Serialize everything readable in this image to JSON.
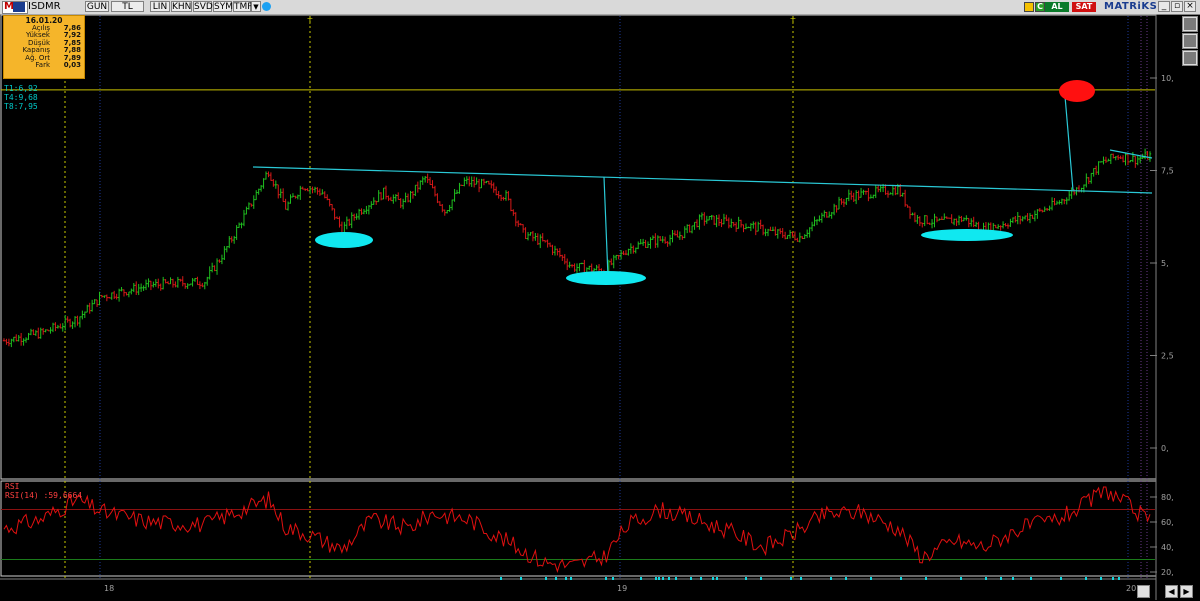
{
  "toolbar": {
    "symbol": "ISDMR",
    "buttons": [
      "GUN",
      "TL",
      "LIN",
      "KHN",
      "SVD",
      "SYM",
      "TMP"
    ],
    "al_label": "AL",
    "sat_label": "SAT",
    "brand": "MATRiKS"
  },
  "infobox": {
    "date": "16.01.20",
    "rows": [
      {
        "label": "Açılış",
        "value": "7,86"
      },
      {
        "label": "Yüksek",
        "value": "7,92"
      },
      {
        "label": "Düşük",
        "value": "7,85"
      },
      {
        "label": "Kapanış",
        "value": "7,88"
      },
      {
        "label": "Ağ. Ort",
        "value": "7,89"
      },
      {
        "label": "Fark",
        "value": "0,03"
      }
    ]
  },
  "trend_labels": [
    "T1:6,92",
    "T4:9,68",
    "T8:7,95"
  ],
  "rsi": {
    "label": "RSI",
    "series_label": "RSI(14)",
    "value": ":59,6664"
  },
  "colors": {
    "up": "#1fbf1f",
    "down": "#d81818",
    "trend": "#2ac9d6",
    "rsi": "#e01010",
    "target": "#ff1010"
  },
  "chart_data": [
    {
      "type": "candlestick",
      "yticks": [
        "10,",
        "7,5",
        "5,",
        "2,5",
        "0,"
      ],
      "ylim": [
        -0.5,
        12
      ],
      "xticks": [
        "18",
        "19",
        "20"
      ],
      "t_markers": [
        "T",
        "T"
      ],
      "resistance_level": 9.68,
      "close_path": [
        {
          "t": 0,
          "v": 2.9
        },
        {
          "t": 15,
          "v": 3.1
        },
        {
          "t": 30,
          "v": 3.5
        },
        {
          "t": 40,
          "v": 4.1
        },
        {
          "t": 60,
          "v": 4.4
        },
        {
          "t": 82,
          "v": 4.5
        },
        {
          "t": 90,
          "v": 5.3
        },
        {
          "t": 100,
          "v": 6.5
        },
        {
          "t": 108,
          "v": 7.5
        },
        {
          "t": 115,
          "v": 6.5
        },
        {
          "t": 122,
          "v": 7.1
        },
        {
          "t": 130,
          "v": 6.9
        },
        {
          "t": 138,
          "v": 5.9
        },
        {
          "t": 145,
          "v": 6.4
        },
        {
          "t": 155,
          "v": 6.9
        },
        {
          "t": 163,
          "v": 6.6
        },
        {
          "t": 172,
          "v": 7.3
        },
        {
          "t": 180,
          "v": 6.4
        },
        {
          "t": 188,
          "v": 7.2
        },
        {
          "t": 197,
          "v": 7.1
        },
        {
          "t": 205,
          "v": 6.8
        },
        {
          "t": 212,
          "v": 5.8
        },
        {
          "t": 222,
          "v": 5.5
        },
        {
          "t": 232,
          "v": 4.9
        },
        {
          "t": 245,
          "v": 4.8
        },
        {
          "t": 255,
          "v": 5.4
        },
        {
          "t": 265,
          "v": 5.6
        },
        {
          "t": 275,
          "v": 5.7
        },
        {
          "t": 285,
          "v": 6.2
        },
        {
          "t": 295,
          "v": 6.1
        },
        {
          "t": 305,
          "v": 6.0
        },
        {
          "t": 315,
          "v": 5.8
        },
        {
          "t": 325,
          "v": 5.7
        },
        {
          "t": 335,
          "v": 6.3
        },
        {
          "t": 345,
          "v": 6.8
        },
        {
          "t": 355,
          "v": 6.9
        },
        {
          "t": 365,
          "v": 7.0
        },
        {
          "t": 372,
          "v": 6.2
        },
        {
          "t": 382,
          "v": 6.1
        },
        {
          "t": 392,
          "v": 6.2
        },
        {
          "t": 400,
          "v": 5.9
        },
        {
          "t": 410,
          "v": 6.1
        },
        {
          "t": 420,
          "v": 6.3
        },
        {
          "t": 430,
          "v": 6.6
        },
        {
          "t": 440,
          "v": 7.1
        },
        {
          "t": 448,
          "v": 7.7
        },
        {
          "t": 455,
          "v": 7.9
        },
        {
          "t": 462,
          "v": 7.8
        },
        {
          "t": 468,
          "v": 7.9
        }
      ],
      "rsi_path": [
        {
          "t": 0,
          "v": 55
        },
        {
          "t": 15,
          "v": 62
        },
        {
          "t": 30,
          "v": 78
        },
        {
          "t": 40,
          "v": 68
        },
        {
          "t": 60,
          "v": 60
        },
        {
          "t": 82,
          "v": 58
        },
        {
          "t": 100,
          "v": 72
        },
        {
          "t": 108,
          "v": 78
        },
        {
          "t": 115,
          "v": 56
        },
        {
          "t": 125,
          "v": 50
        },
        {
          "t": 138,
          "v": 38
        },
        {
          "t": 150,
          "v": 62
        },
        {
          "t": 165,
          "v": 55
        },
        {
          "t": 175,
          "v": 67
        },
        {
          "t": 190,
          "v": 62
        },
        {
          "t": 205,
          "v": 45
        },
        {
          "t": 220,
          "v": 28
        },
        {
          "t": 232,
          "v": 25
        },
        {
          "t": 245,
          "v": 32
        },
        {
          "t": 255,
          "v": 58
        },
        {
          "t": 268,
          "v": 70
        },
        {
          "t": 282,
          "v": 62
        },
        {
          "t": 295,
          "v": 54
        },
        {
          "t": 310,
          "v": 40
        },
        {
          "t": 320,
          "v": 48
        },
        {
          "t": 335,
          "v": 66
        },
        {
          "t": 350,
          "v": 68
        },
        {
          "t": 365,
          "v": 55
        },
        {
          "t": 375,
          "v": 32
        },
        {
          "t": 388,
          "v": 45
        },
        {
          "t": 400,
          "v": 40
        },
        {
          "t": 415,
          "v": 55
        },
        {
          "t": 430,
          "v": 62
        },
        {
          "t": 440,
          "v": 72
        },
        {
          "t": 450,
          "v": 86
        },
        {
          "t": 460,
          "v": 72
        },
        {
          "t": 468,
          "v": 59.67
        }
      ],
      "rsi_levels": [
        30,
        70
      ],
      "rsi_yticks": [
        "80,",
        "60,",
        "40,",
        "20,"
      ],
      "rsi_ylim": [
        15,
        90
      ]
    }
  ]
}
